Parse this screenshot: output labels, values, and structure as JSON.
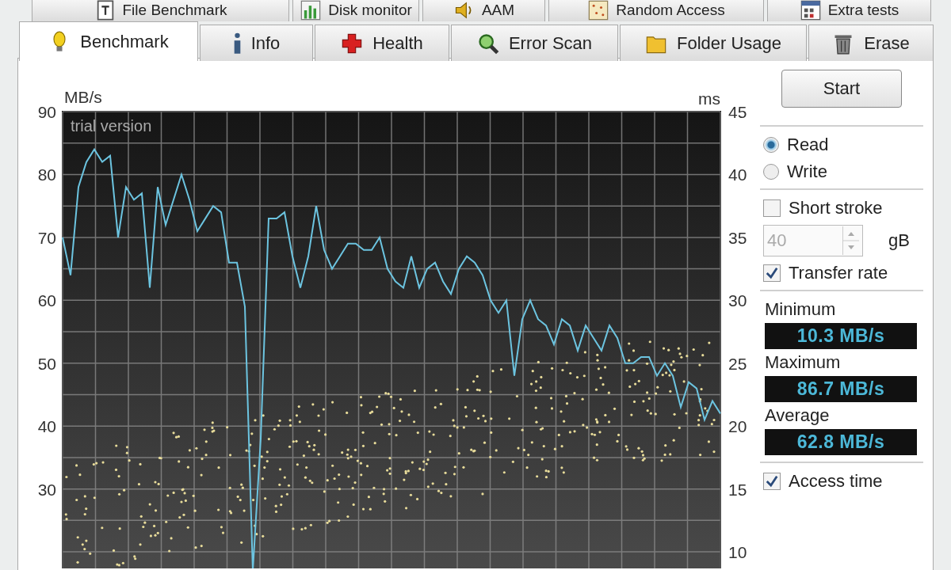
{
  "tabs_row_1": [
    {
      "label": "File Benchmark",
      "selected": false
    },
    {
      "label": "Disk monitor",
      "selected": false
    },
    {
      "label": "AAM",
      "selected": false
    },
    {
      "label": "Random Access",
      "selected": false
    },
    {
      "label": "Extra tests",
      "selected": false
    }
  ],
  "tabs_row_2": [
    {
      "label": "Benchmark",
      "selected": true
    },
    {
      "label": "Info",
      "selected": false
    },
    {
      "label": "Health",
      "selected": false
    },
    {
      "label": "Error Scan",
      "selected": false
    },
    {
      "label": "Folder Usage",
      "selected": false
    },
    {
      "label": "Erase",
      "selected": false
    }
  ],
  "chart": {
    "right_axis": {
      "label": "ms",
      "ticks": [
        "45",
        "40",
        "35",
        "30",
        "25",
        "20",
        "15",
        "10"
      ]
    },
    "chart_data": {
      "type": "line",
      "ylabel": "MB/s",
      "ylim": [
        17,
        90
      ],
      "yticks": [
        30,
        40,
        50,
        60,
        70,
        80,
        90
      ],
      "grid": true,
      "annotations": [
        {
          "text": "trial version"
        }
      ],
      "series": [
        {
          "name": "Transfer rate",
          "color": "#6cc4e0",
          "values": [
            70,
            64,
            78,
            82,
            84,
            82,
            83,
            70,
            78,
            76,
            77,
            62,
            78,
            72,
            76,
            80,
            76,
            71,
            73,
            75,
            74,
            66,
            66,
            59,
            17,
            38,
            73,
            73,
            74,
            67,
            62,
            67,
            75,
            68,
            65,
            67,
            69,
            69,
            68,
            68,
            70,
            65,
            63,
            62,
            67,
            62,
            65,
            66,
            63,
            61,
            65,
            67,
            66,
            64,
            60,
            58,
            60,
            48,
            57,
            60,
            57,
            56,
            53,
            57,
            56,
            52,
            56,
            54,
            52,
            56,
            54,
            50,
            50,
            51,
            51,
            48,
            50,
            48,
            43,
            47,
            46,
            41,
            44,
            42
          ]
        }
      ]
    }
  },
  "controls": {
    "start_button": "Start",
    "mode": [
      {
        "label": "Read",
        "selected": true
      },
      {
        "label": "Write",
        "selected": false
      }
    ],
    "short_stroke": {
      "label": "Short stroke",
      "checked": false
    },
    "stroke_size": {
      "value": "40",
      "unit": "gB",
      "disabled": true
    },
    "transfer_rate": {
      "checked": true
    },
    "readouts": [
      {
        "label": "Minimum",
        "value": "10.3 MB/s"
      },
      {
        "label": "Maximum",
        "value": "86.7 MB/s"
      },
      {
        "label": "Average",
        "value": "62.8 MB/s"
      }
    ],
    "access_time": {
      "label": "Access time",
      "checked": true
    }
  }
}
